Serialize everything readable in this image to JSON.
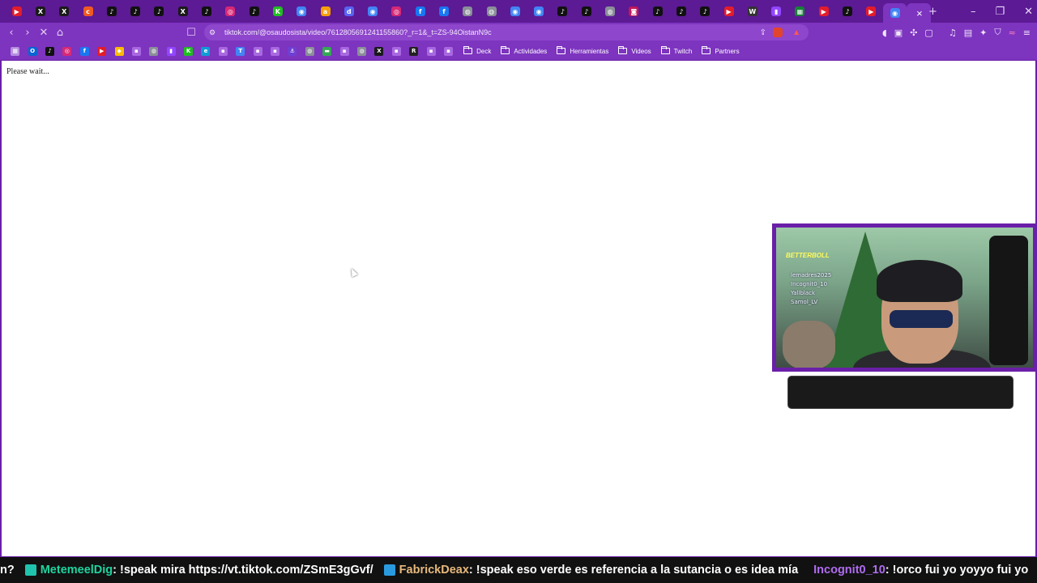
{
  "browser": {
    "tab_icons": [
      "youtube",
      "x",
      "x",
      "crunchyroll",
      "tiktok",
      "tiktok",
      "tiktok",
      "x",
      "tiktok",
      "instagram",
      "tiktok",
      "kick",
      "chrome",
      "amazon",
      "discord",
      "chrome",
      "instagram",
      "facebook",
      "facebook",
      "globe",
      "globe",
      "chrome",
      "chrome",
      "tiktok",
      "tiktok",
      "globe",
      "cast",
      "tiktok",
      "tiktok",
      "tiktok",
      "youtube",
      "wix",
      "twitch",
      "sheets",
      "youtube",
      "tiktok",
      "youtube",
      "chrome"
    ],
    "active_tab_close": "×",
    "new_tab": "+",
    "window_controls": [
      "–",
      "❐",
      "✕"
    ],
    "url": "tiktok.com/@osaudosista/video/7612805691241155860?_r=1&_t=ZS-94OistanN9c",
    "bookmarks_icons": [
      "apps",
      "outlook",
      "tiktok",
      "instagram",
      "facebook",
      "youtube",
      "keep",
      "app",
      "globe",
      "twitch",
      "kick",
      "edge",
      "app",
      "translate",
      "app",
      "app",
      "anchor",
      "globe",
      "chat",
      "app",
      "globe",
      "x",
      "app",
      "revolut",
      "app",
      "app"
    ],
    "bookmark_folders": [
      {
        "label": "Deck"
      },
      {
        "label": "Actividades"
      },
      {
        "label": "Herramientas"
      },
      {
        "label": "Videos"
      },
      {
        "label": "Twitch"
      },
      {
        "label": "Partners"
      }
    ]
  },
  "page": {
    "status_text": "Please wait..."
  },
  "webcam": {
    "overlay_title": "BETTERBOLL",
    "names": [
      "lemadres2025",
      "Incognit0_10",
      "Yallblack",
      "Samol_LV"
    ]
  },
  "chat_ticker": {
    "lead": "n?",
    "messages": [
      {
        "user": "MetemeelDig",
        "user_color": "#1fd49f",
        "text": ": !speak mira https://vt.tiktok.com/ZSmE3gGvf/"
      },
      {
        "user": "FabrickDeax",
        "user_color": "#e8b97c",
        "text": ": !speak eso verde es referencia a la sutancia o es idea mía"
      },
      {
        "user": "Incognit0_10",
        "user_color": "#b06cf0",
        "text": ": !orco fui yo yoyyo fui yo"
      }
    ]
  },
  "colors": {
    "browser_frame": "#7d34bf",
    "tab_strip": "#5c1a94",
    "page_bg": "#ffffff",
    "ticker_bg": "#111111"
  }
}
